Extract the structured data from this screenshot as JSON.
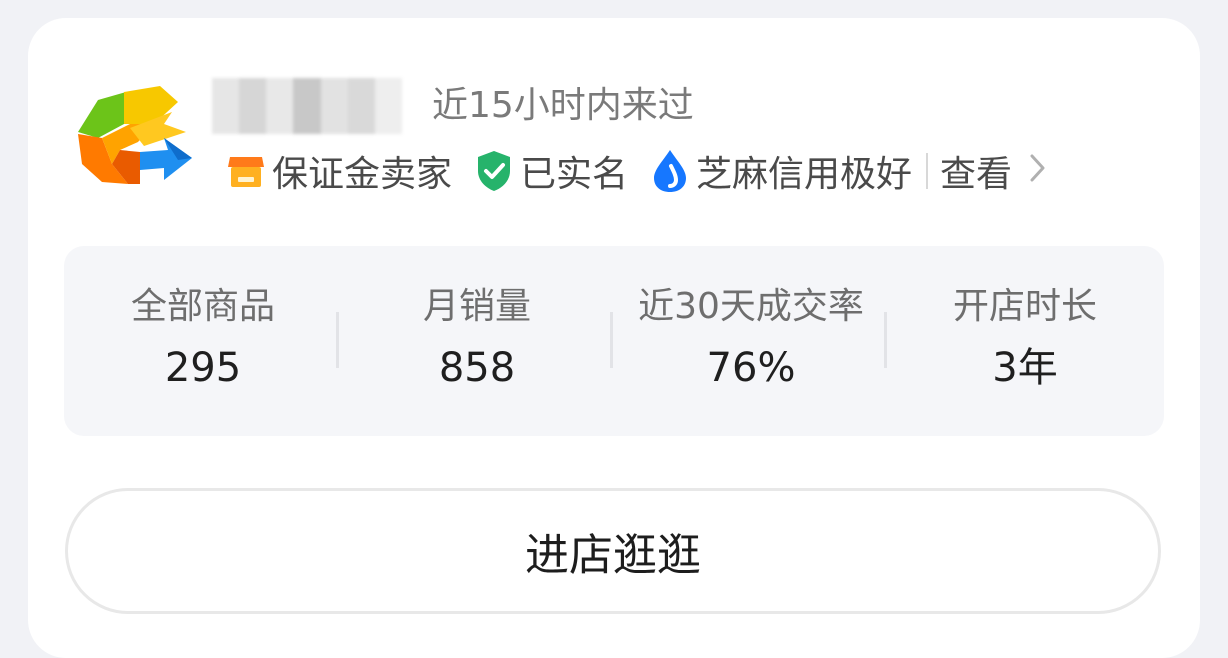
{
  "shop": {
    "logo_icon": "tencent-games-logo-icon",
    "last_visit": "近15小时内来过",
    "badges": [
      {
        "label": "保证金卖家",
        "icon": "deposit-seller-icon",
        "color": "#ff9e1b"
      },
      {
        "label": "已实名",
        "icon": "verified-shield-icon",
        "color": "#26b36b"
      },
      {
        "label": "芝麻信用极好",
        "icon": "sesame-credit-icon",
        "color": "#1677ff"
      }
    ],
    "view_label": "查看"
  },
  "stats": [
    {
      "label": "全部商品",
      "value": "295"
    },
    {
      "label": "月销量",
      "value": "858"
    },
    {
      "label": "近30天成交率",
      "value": "76%"
    },
    {
      "label": "开店时长",
      "value": "3年"
    }
  ],
  "enter_button": {
    "label": "进店逛逛"
  }
}
